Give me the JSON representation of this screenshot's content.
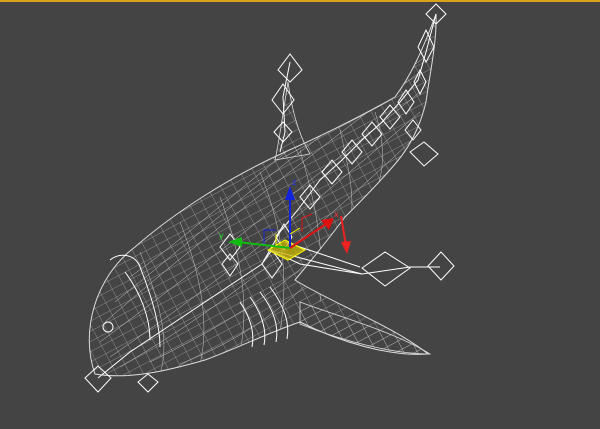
{
  "viewport": {
    "background_color": "#444444",
    "active_border_color": "#d9a21a",
    "wireframe_color": "#d8d8d8",
    "bone_color": "#ffffff",
    "selection_color": "#ffff00"
  },
  "model": {
    "type": "shark",
    "display_mode": "wireframe",
    "has_bone_rig": true
  },
  "gizmo": {
    "type": "move",
    "x_axis_color": "#dd1111",
    "y_axis_color": "#11bb11",
    "z_axis_color": "#1122dd",
    "axis_labels": {
      "x": "x",
      "y": "y",
      "z": "z"
    }
  }
}
